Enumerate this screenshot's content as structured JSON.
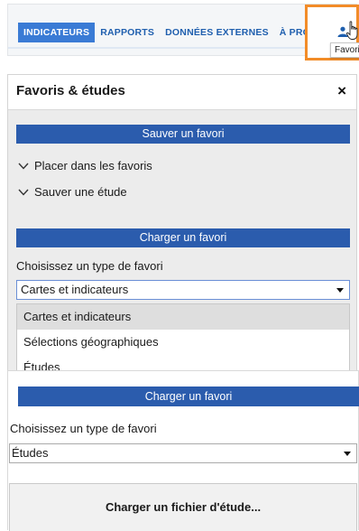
{
  "nav": {
    "tabs": [
      {
        "label": "INDICATEURS",
        "active": true
      },
      {
        "label": "RAPPORTS",
        "active": false
      },
      {
        "label": "DONNÉES EXTERNES",
        "active": false
      },
      {
        "label": "À PROPOS...",
        "active": false
      }
    ],
    "favorites_icon": "person-icon",
    "cursor_icon": "hand-pointer-icon",
    "tooltip": "Favoris",
    "highlight_color": "#f28c28",
    "active_tab_color": "#3a7bd5",
    "tab_text_color": "#1f5fae"
  },
  "favorites_panel": {
    "title": "Favoris & études",
    "close_label": "×",
    "save_section_header": "Sauver un favori",
    "expanders": [
      {
        "label": "Placer dans les favoris",
        "icon": "chevron-down-icon"
      },
      {
        "label": "Sauver une étude",
        "icon": "chevron-down-icon"
      }
    ],
    "load_section_header": "Charger un favori",
    "type_label": "Choisissez un type de favori",
    "type_select_value": "Cartes et indicateurs",
    "dropdown_options": [
      {
        "label": "Cartes et indicateurs",
        "highlighted": true
      },
      {
        "label": "Sélections géographiques",
        "highlighted": false
      },
      {
        "label": "Études",
        "highlighted": false
      }
    ],
    "header_bar_color": "#2b5cad"
  },
  "lower_panel": {
    "load_section_header": "Charger un favori",
    "type_label": "Choisissez un type de favori",
    "type_select_value": "Études",
    "load_file_button": "Charger un fichier d'étude..."
  }
}
